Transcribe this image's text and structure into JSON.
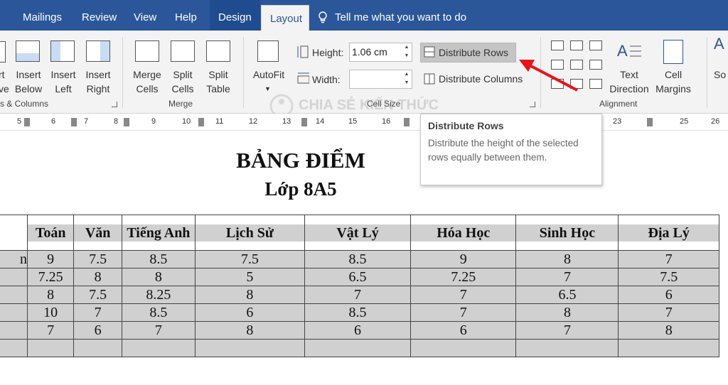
{
  "tabs": [
    "Mailings",
    "Review",
    "View",
    "Help",
    "Design",
    "Layout"
  ],
  "tell_me": "Tell me what you want to do",
  "ribbon": {
    "rows_cols": {
      "insert_below": [
        "Insert",
        "Below"
      ],
      "insert_left": [
        "Insert",
        "Left"
      ],
      "insert_right": [
        "Insert",
        "Right"
      ],
      "partial_delete": [
        "rt",
        "ve"
      ],
      "group_label": "s & Columns"
    },
    "merge": {
      "merge_cells": [
        "Merge",
        "Cells"
      ],
      "split_cells": [
        "Split",
        "Cells"
      ],
      "split_table": [
        "Split",
        "Table"
      ],
      "group_label": "Merge"
    },
    "cell_size": {
      "autofit": "AutoFit",
      "height_label": "Height:",
      "height_value": "1.06 cm",
      "width_label": "Width:",
      "width_value": "",
      "distribute_rows": "Distribute Rows",
      "distribute_columns": "Distribute Columns",
      "group_label": "Cell Size"
    },
    "alignment": {
      "text_direction": [
        "Text",
        "Direction"
      ],
      "cell_margins": [
        "Cell",
        "Margins"
      ],
      "group_label": "Alignment"
    },
    "sort_partial": "So"
  },
  "ruler_numbers": [
    "5",
    "6",
    "7",
    "8",
    "9",
    "10",
    "11",
    "12",
    "13",
    "14",
    "15",
    "16",
    "23",
    "25",
    "26"
  ],
  "tooltip": {
    "title": "Distribute Rows",
    "description": "Distribute the height of the selected rows equally between them."
  },
  "watermark": "CHIA SẺ KIẾN THỨC",
  "document": {
    "title": "BẢNG ĐIỂM",
    "subtitle": "Lớp 8A5",
    "table": {
      "headers": [
        "",
        "Toán",
        "Văn",
        "Tiếng Anh",
        "Lịch Sử",
        "Vật Lý",
        "Hóa Học",
        "Sinh Học",
        "Địa Lý"
      ],
      "rows": [
        [
          "n",
          "9",
          "7.5",
          "8.5",
          "7.5",
          "8.5",
          "9",
          "8",
          "7"
        ],
        [
          "",
          "7.25",
          "8",
          "8",
          "5",
          "6.5",
          "7.25",
          "7",
          "7.5"
        ],
        [
          "",
          "8",
          "7.5",
          "8.25",
          "8",
          "7",
          "7",
          "6.5",
          "6"
        ],
        [
          "",
          "10",
          "7",
          "8.5",
          "6",
          "8.5",
          "7",
          "8",
          "7"
        ],
        [
          "",
          "7",
          "6",
          "7",
          "8",
          "6",
          "6",
          "7",
          "8"
        ],
        [
          "",
          "",
          "",
          "",
          "",
          "",
          "",
          "",
          ""
        ]
      ]
    }
  },
  "colors": {
    "tab_bar": "#2b579a",
    "ribbon_bg": "#f3f3f3",
    "cell_shading": "#d0d0d0",
    "arrow": "#e8141b"
  }
}
